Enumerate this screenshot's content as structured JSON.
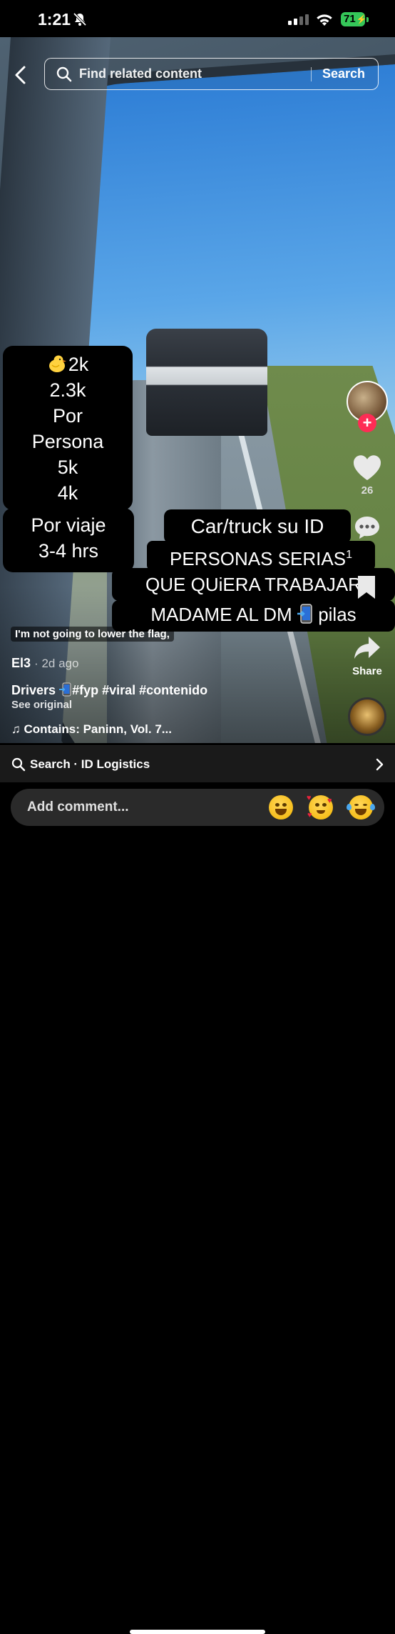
{
  "status_bar": {
    "time": "1:21",
    "battery": "71"
  },
  "top_search": {
    "placeholder": "Find related content",
    "search_label": "Search"
  },
  "overlay": {
    "price_lines": [
      "2k",
      "2.3k",
      "Por",
      "Persona",
      "5k",
      "4k"
    ],
    "trip_lines": [
      "Por viaje",
      "3-4 hrs"
    ],
    "promo_line1": "Car/truck su ID",
    "promo_line2": "PERSONAS SERIAS",
    "promo_line2_sup": "1",
    "promo_line3": "QUE QUiERA TRABAJAR",
    "promo_line4": "MADAME AL DM",
    "promo_line4_end": "pilas"
  },
  "subtitle": "I'm not going to lower the flag,",
  "actions": {
    "likes": "26",
    "share_label": "Share"
  },
  "post": {
    "author": "El3",
    "time_ago": "2d ago",
    "description_prefix": "Drivers",
    "description_tags": "#fyp #viral #contenido",
    "see_original": "See original",
    "music": "Contains: Paninn, Vol. 7..."
  },
  "related_search": {
    "label": "Search · ID Logistics"
  },
  "comment_bar": {
    "placeholder": "Add comment..."
  },
  "colors": {
    "follow_accent": "#fe2c55",
    "battery": "#35c759"
  }
}
